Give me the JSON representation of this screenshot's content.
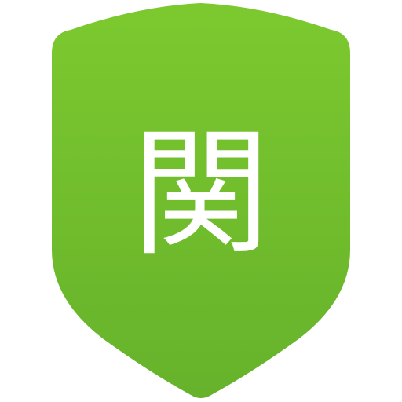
{
  "icon": {
    "name": "shield-icon",
    "character": "関",
    "colors": {
      "shield_top": "#7cc92f",
      "shield_bottom": "#66b22b",
      "glyph": "#ffffff",
      "background": "#ffffff"
    }
  }
}
